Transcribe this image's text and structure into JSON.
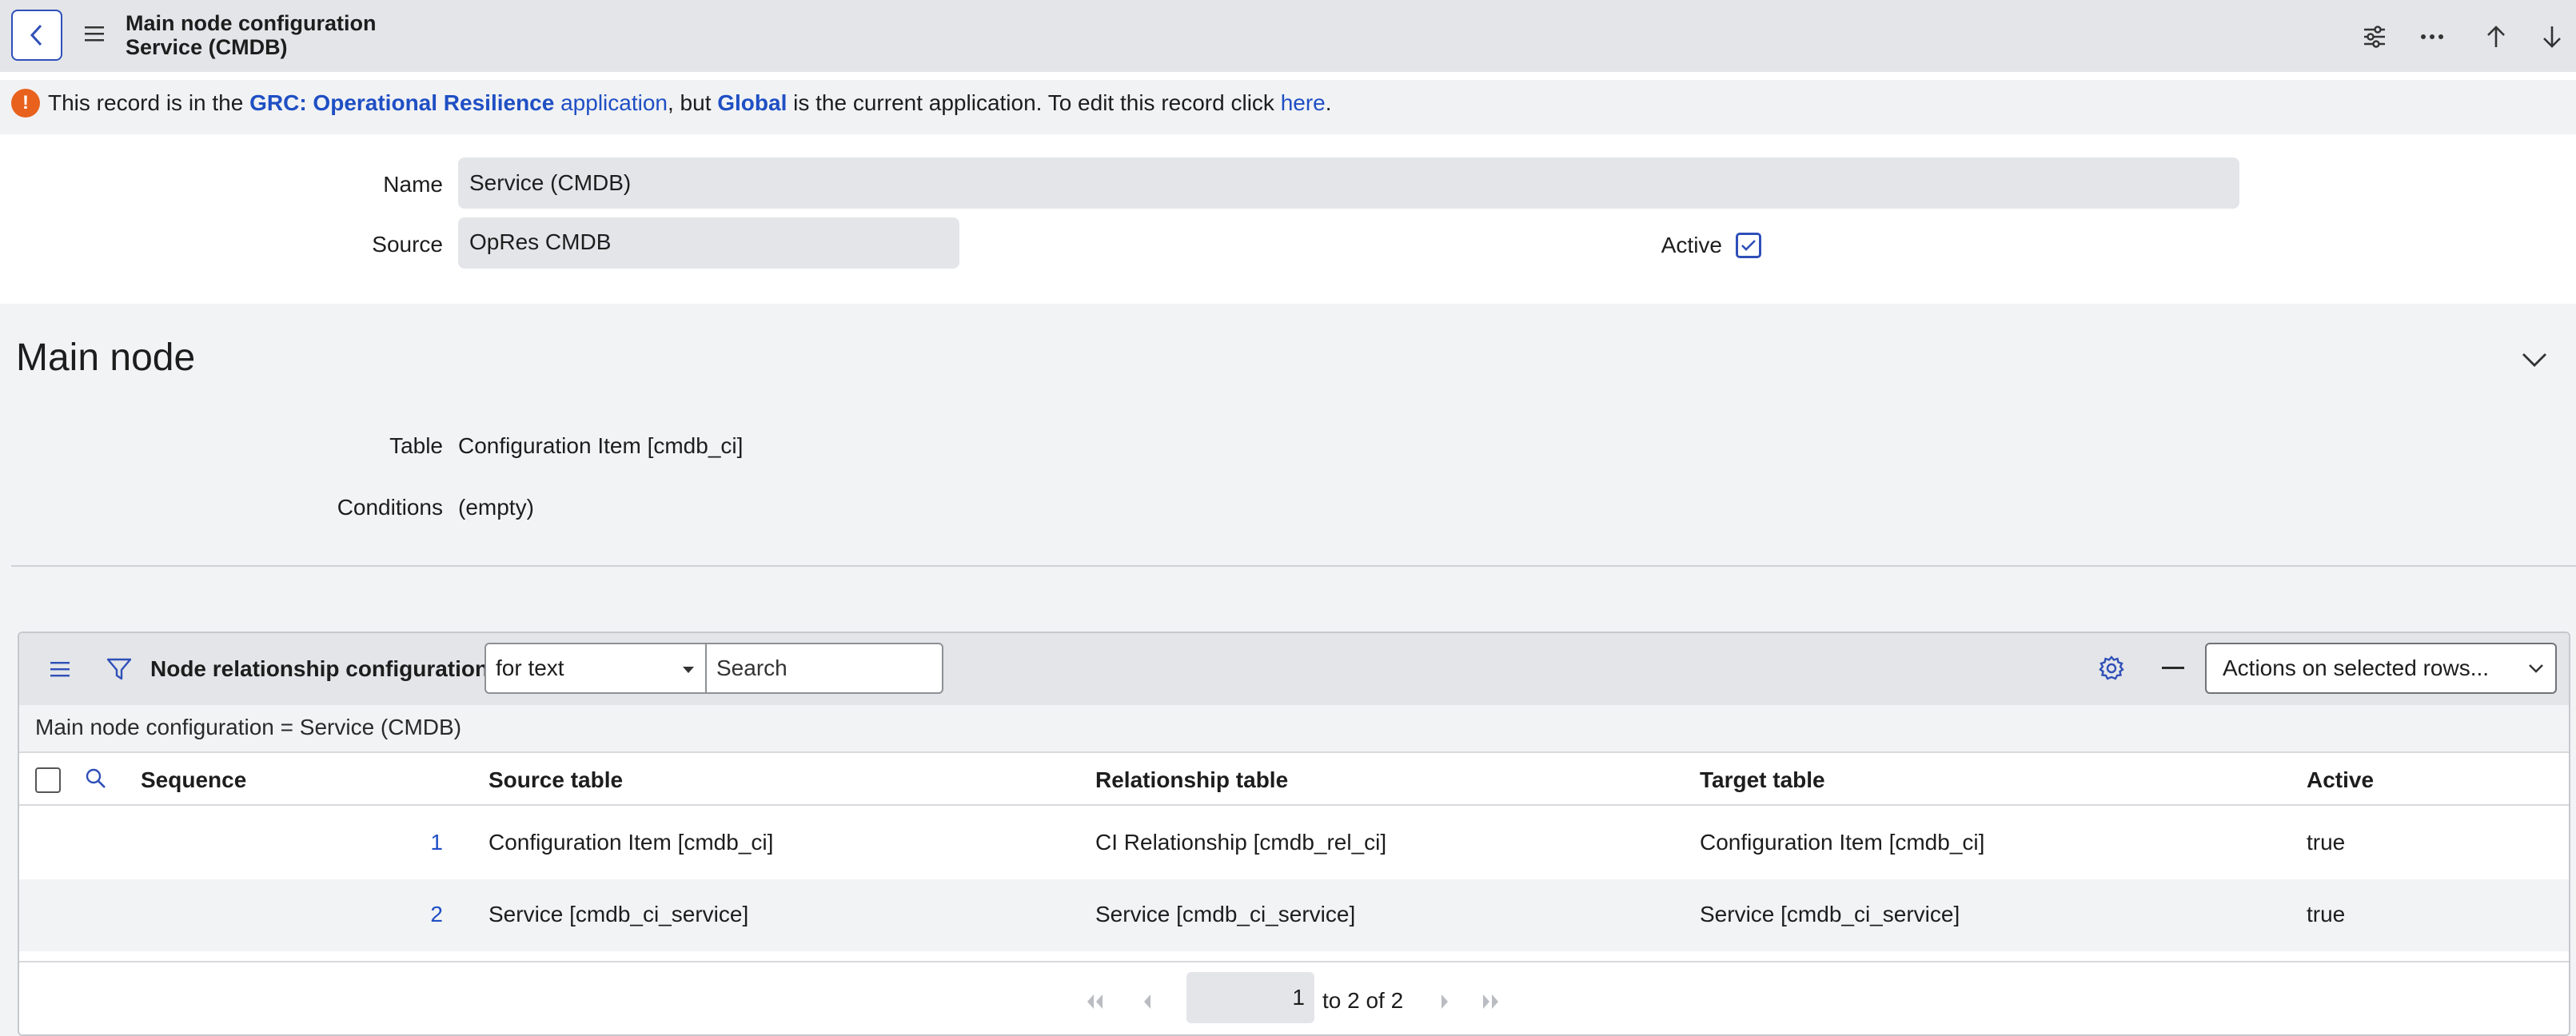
{
  "header": {
    "title_line1": "Main node configuration",
    "title_line2": "Service (CMDB)"
  },
  "banner": {
    "part1": "This record is in the ",
    "app_name": "GRC: Operational Resilience",
    "app_word": " application",
    "part2": ", but ",
    "current_app": "Global",
    "part3": " is the current application. To edit this record click ",
    "here": "here",
    "part4": "."
  },
  "form": {
    "name_label": "Name",
    "name_value": "Service (CMDB)",
    "source_label": "Source",
    "source_value": "OpRes CMDB",
    "active_label": "Active",
    "active_checked": true
  },
  "main_node": {
    "title": "Main node",
    "table_label": "Table",
    "table_value": "Configuration Item [cmdb_ci]",
    "conditions_label": "Conditions",
    "conditions_value": "(empty)"
  },
  "related_list": {
    "title": "Node relationship configurations",
    "search_field": "for text",
    "search_placeholder": "Search",
    "actions_label": "Actions on selected rows...",
    "breadcrumb": "Main node configuration = Service (CMDB)",
    "columns": [
      "Sequence",
      "Source table",
      "Relationship table",
      "Target table",
      "Active"
    ],
    "rows": [
      {
        "seq": "1",
        "source": "Configuration Item [cmdb_ci]",
        "relationship": "CI Relationship [cmdb_rel_ci]",
        "target": "Configuration Item [cmdb_ci]",
        "active": "true"
      },
      {
        "seq": "2",
        "source": "Service [cmdb_ci_service]",
        "relationship": "Service [cmdb_ci_service]",
        "target": "Service [cmdb_ci_service]",
        "active": "true"
      }
    ],
    "pager": {
      "current": "1",
      "range_text": "to 2 of 2"
    }
  },
  "icons": {
    "back": "chevron-left-icon",
    "menu": "hamburger-icon",
    "settings": "sliders-icon",
    "more": "ellipsis-icon",
    "prev": "arrow-up-icon",
    "next": "arrow-down-icon",
    "warning": "exclamation-icon"
  },
  "colors": {
    "accent": "#2f4fb8",
    "link": "#1f4fc4",
    "warning": "#e8621d",
    "header_bg": "#e3e5e8"
  }
}
